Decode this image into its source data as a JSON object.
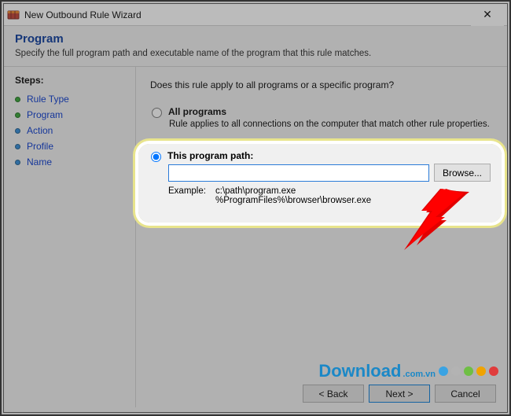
{
  "titlebar": {
    "title": "New Outbound Rule Wizard",
    "close_tooltip": "Close"
  },
  "header": {
    "title": "Program",
    "subtitle": "Specify the full program path and executable name of the program that this rule matches."
  },
  "steps": {
    "heading": "Steps:",
    "items": [
      {
        "label": "Rule Type",
        "state": "done"
      },
      {
        "label": "Program",
        "state": "done"
      },
      {
        "label": "Action",
        "state": "pending"
      },
      {
        "label": "Profile",
        "state": "pending"
      },
      {
        "label": "Name",
        "state": "pending"
      }
    ]
  },
  "content": {
    "question": "Does this rule apply to all programs or a specific program?",
    "all_programs": {
      "label": "All programs",
      "desc": "Rule applies to all connections on the computer that match other rule properties."
    },
    "this_program": {
      "label": "This program path:",
      "value": "",
      "browse": "Browse...",
      "example_label": "Example:",
      "example_text": "c:\\path\\program.exe\n%ProgramFiles%\\browser\\browser.exe"
    }
  },
  "footer": {
    "back": "< Back",
    "next": "Next >",
    "cancel": "Cancel"
  },
  "watermark": {
    "text": "Download",
    "suffix": ".com.vn",
    "dot_colors": [
      "#3aa3e3",
      "#b3b3b3",
      "#6fbf44",
      "#f0a300",
      "#e03c3c"
    ]
  }
}
